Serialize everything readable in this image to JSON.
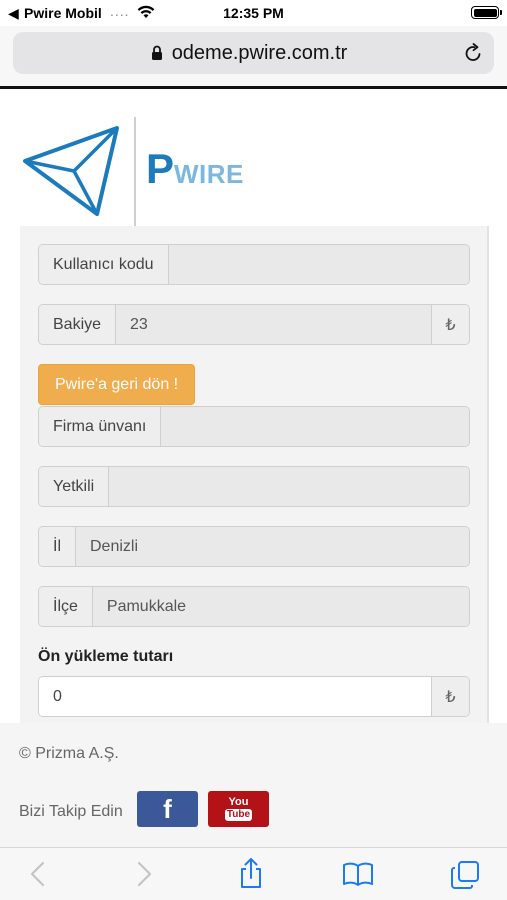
{
  "status_bar": {
    "back_glyph": "◀",
    "carrier": "Pwire Mobil",
    "signal_dots": "....",
    "time": "12:35 PM",
    "battery_level": 1.0
  },
  "browser": {
    "url": "odeme.pwire.com.tr",
    "icons": [
      "lock-icon",
      "reload-icon",
      "back-arrow-icon",
      "forward-arrow-icon",
      "share-icon",
      "bookmarks-icon",
      "tabs-icon"
    ]
  },
  "logo": {
    "initial": "P",
    "rest": "WIRE"
  },
  "form": {
    "user_code": {
      "label": "Kullanıcı kodu",
      "value": ""
    },
    "balance": {
      "label": "Bakiye",
      "value": "23",
      "currency": "₺"
    },
    "back_button": "Pwire'a geri dön !",
    "company": {
      "label": "Firma ünvanı",
      "value": ""
    },
    "contact": {
      "label": "Yetkili",
      "value": ""
    },
    "city": {
      "label": "İl",
      "value": "Denizli"
    },
    "district": {
      "label": "İlçe",
      "value": "Pamukkale"
    },
    "amount": {
      "label": "Ön yükleme tutarı",
      "value": "0",
      "currency": "₺"
    }
  },
  "footer": {
    "copyright": "© Prizma A.Ş.",
    "follow_text": "Bizi Takip Edin",
    "facebook_glyph": "f",
    "youtube_top": "You",
    "youtube_bottom": "Tube"
  },
  "colors": {
    "brand_blue": "#1c7bbd",
    "warning_orange": "#f0ad4e",
    "facebook": "#3b5998",
    "youtube": "#b31217",
    "ios_blue": "#1a7cf5"
  }
}
